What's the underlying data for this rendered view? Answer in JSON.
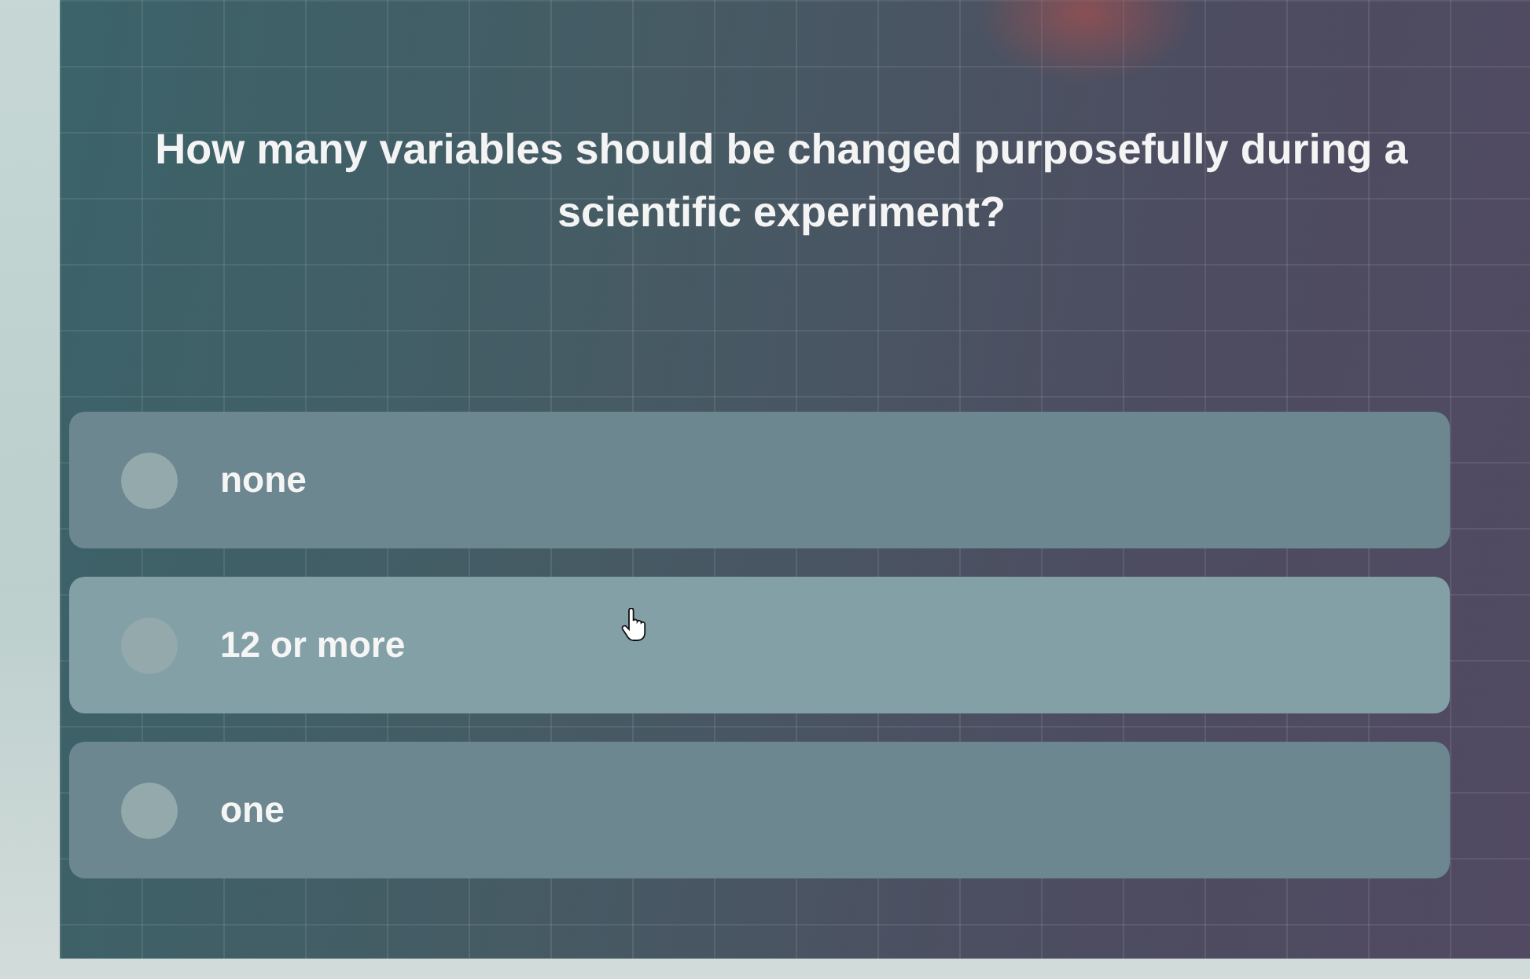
{
  "question": {
    "text": "How many variables should be changed purposefully during a scientific experiment?"
  },
  "options": [
    {
      "label": "none",
      "selected": false,
      "hovered": false
    },
    {
      "label": "12 or more",
      "selected": false,
      "hovered": true
    },
    {
      "label": "one",
      "selected": false,
      "hovered": false
    }
  ]
}
